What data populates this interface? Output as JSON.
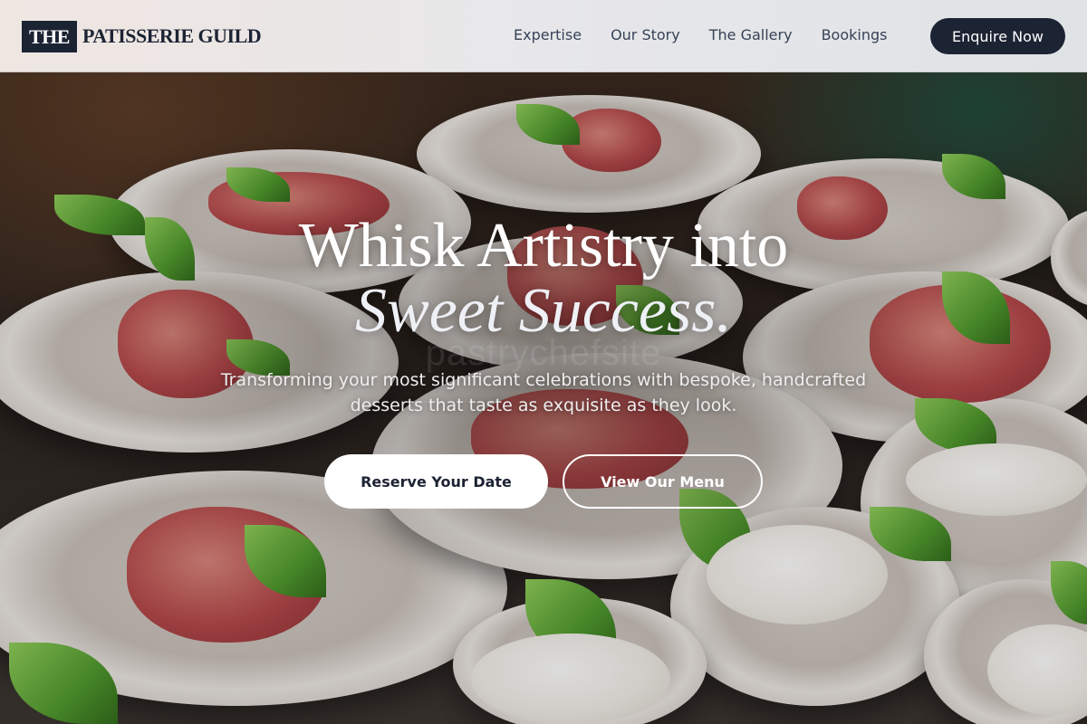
{
  "brand": {
    "mark": "THE",
    "name": "PATISSERIE GUILD"
  },
  "nav": {
    "links": [
      "Expertise",
      "Our Story",
      "The Gallery",
      "Bookings"
    ],
    "cta": "Enquire Now"
  },
  "hero": {
    "headline_line1": "Whisk Artistry into",
    "headline_line2": "Sweet Success.",
    "subtext": "Transforming your most significant celebrations with bespoke, handcrafted desserts that taste as exquisite as they look.",
    "primary_button": "Reserve Your Date",
    "secondary_button": "View Our Menu",
    "background_image": "plated-appetizers-photo",
    "watermark": "pastrychefsite"
  },
  "colors": {
    "navy": "#1c2333",
    "nav_text": "#374256",
    "white": "#ffffff"
  }
}
